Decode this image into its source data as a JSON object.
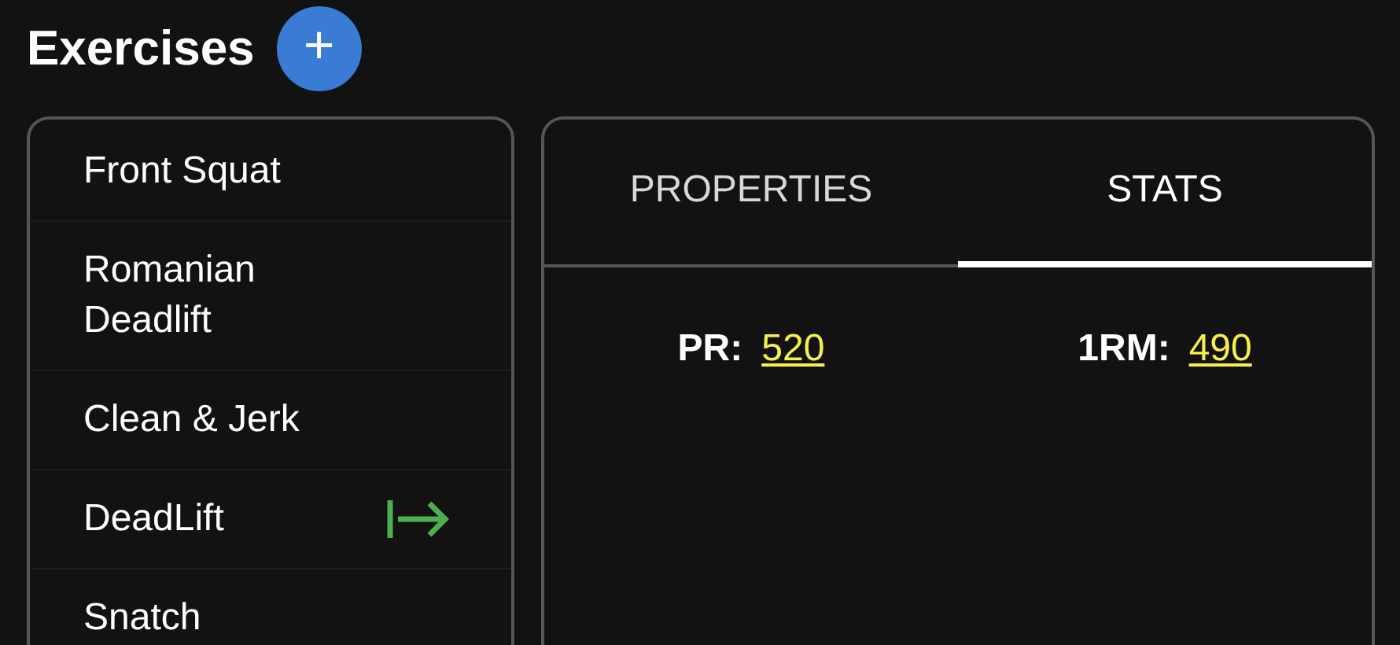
{
  "header": {
    "title": "Exercises",
    "add_button": "+"
  },
  "exercises": [
    {
      "name": "Front Squat",
      "selected": false
    },
    {
      "name": "Romanian Deadlift",
      "selected": false
    },
    {
      "name": "Clean & Jerk",
      "selected": false
    },
    {
      "name": "DeadLift",
      "selected": true
    },
    {
      "name": "Snatch",
      "selected": false
    }
  ],
  "tabs": [
    {
      "label": "PROPERTIES",
      "selected": false
    },
    {
      "label": "STATS",
      "selected": true
    }
  ],
  "stats": [
    {
      "label": "PR:",
      "value": "520"
    },
    {
      "label": "1RM:",
      "value": "490"
    }
  ]
}
